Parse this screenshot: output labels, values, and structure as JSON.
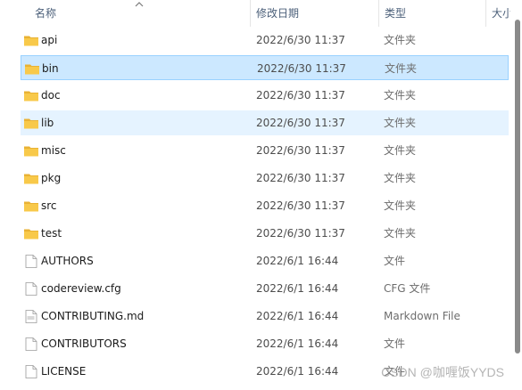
{
  "columns": {
    "name": "名称",
    "date": "修改日期",
    "type": "类型",
    "size": "大小"
  },
  "files": [
    {
      "name": "api",
      "date": "2022/6/30 11:37",
      "type": "文件夹",
      "kind": "folder",
      "state": ""
    },
    {
      "name": "bin",
      "date": "2022/6/30 11:37",
      "type": "文件夹",
      "kind": "folder",
      "state": "selected"
    },
    {
      "name": "doc",
      "date": "2022/6/30 11:37",
      "type": "文件夹",
      "kind": "folder",
      "state": ""
    },
    {
      "name": "lib",
      "date": "2022/6/30 11:37",
      "type": "文件夹",
      "kind": "folder",
      "state": "hover"
    },
    {
      "name": "misc",
      "date": "2022/6/30 11:37",
      "type": "文件夹",
      "kind": "folder",
      "state": ""
    },
    {
      "name": "pkg",
      "date": "2022/6/30 11:37",
      "type": "文件夹",
      "kind": "folder",
      "state": ""
    },
    {
      "name": "src",
      "date": "2022/6/30 11:37",
      "type": "文件夹",
      "kind": "folder",
      "state": ""
    },
    {
      "name": "test",
      "date": "2022/6/30 11:37",
      "type": "文件夹",
      "kind": "folder",
      "state": ""
    },
    {
      "name": "AUTHORS",
      "date": "2022/6/1 16:44",
      "type": "文件",
      "kind": "file",
      "state": ""
    },
    {
      "name": "codereview.cfg",
      "date": "2022/6/1 16:44",
      "type": "CFG 文件",
      "kind": "file",
      "state": ""
    },
    {
      "name": "CONTRIBUTING.md",
      "date": "2022/6/1 16:44",
      "type": "Markdown File",
      "kind": "md-file",
      "state": ""
    },
    {
      "name": "CONTRIBUTORS",
      "date": "2022/6/1 16:44",
      "type": "文件",
      "kind": "file",
      "state": ""
    },
    {
      "name": "LICENSE",
      "date": "2022/6/1 16:44",
      "type": "文件",
      "kind": "file",
      "state": ""
    }
  ],
  "watermark": "CSDN @咖喱饭YYDS",
  "colors": {
    "selected_bg": "#cce8ff",
    "hover_bg": "#e5f3ff",
    "folder": "#f8c94a"
  }
}
